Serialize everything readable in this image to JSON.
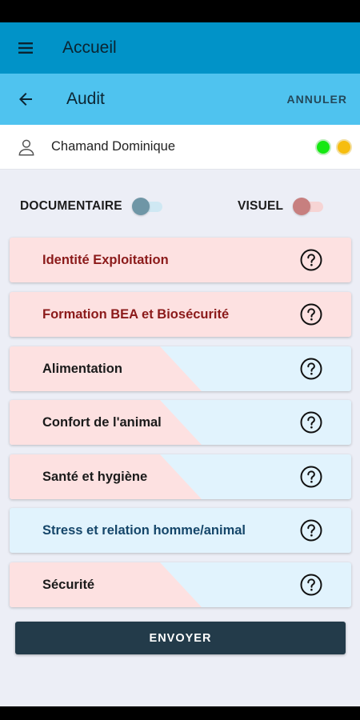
{
  "app_bar": {
    "title": "Accueil",
    "menu_icon": "hamburger-menu-icon"
  },
  "sub_bar": {
    "title": "Audit",
    "cancel_label": "ANNULER",
    "back_icon": "arrow-back-icon"
  },
  "user": {
    "name": "Chamand Dominique",
    "icon": "person-outline-icon",
    "status_colors": [
      "#15e812",
      "#f6bd0f"
    ]
  },
  "toggles": {
    "documentaire": {
      "label": "DOCUMENTAIRE",
      "on": false,
      "color": "#6f96a6"
    },
    "visuel": {
      "label": "VISUEL",
      "on": false,
      "color": "#c77f7f"
    }
  },
  "sections": [
    {
      "label": "Identité Exploitation",
      "style": "pink"
    },
    {
      "label": "Formation BEA et Biosécurité",
      "style": "pink"
    },
    {
      "label": "Alimentation",
      "style": "split"
    },
    {
      "label": "Confort de l'animal",
      "style": "split"
    },
    {
      "label": "Santé et hygiène",
      "style": "split"
    },
    {
      "label": "Stress et relation homme/animal",
      "style": "blue"
    },
    {
      "label": "Sécurité",
      "style": "split"
    }
  ],
  "send_button": {
    "label": "ENVOYER"
  },
  "colors": {
    "app_bar": "#0193c8",
    "sub_bar": "#4fc3ef",
    "pink_card": "#fde1e1",
    "blue_card": "#e1f3fd",
    "button": "#233b4a"
  }
}
